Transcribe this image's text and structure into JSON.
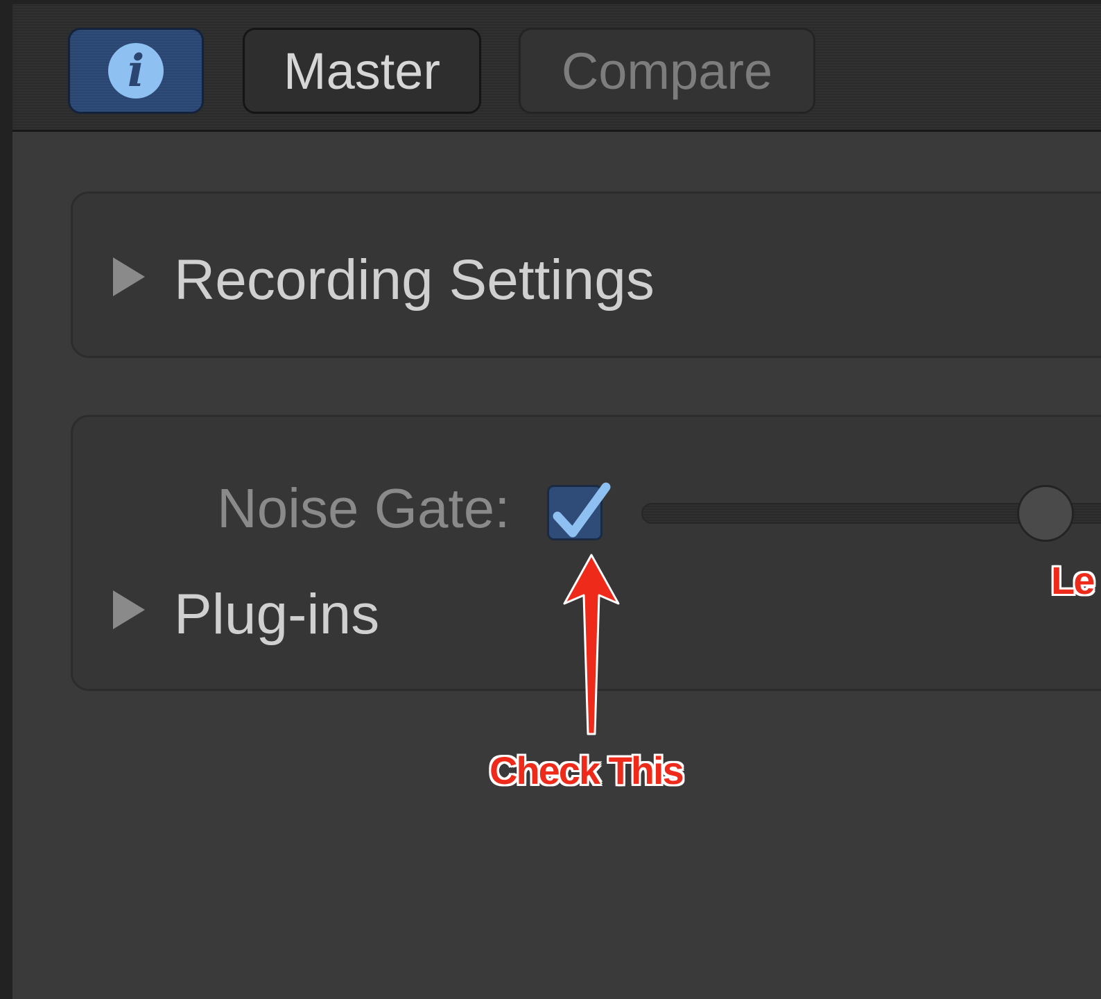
{
  "toolbar": {
    "info_button": {
      "icon": "info-icon",
      "glyph": "i",
      "accent": "#8fc0f2"
    },
    "master_label": "Master",
    "compare_label": "Compare"
  },
  "sections": {
    "recording_settings": {
      "label": "Recording Settings",
      "expanded": false
    },
    "plugins": {
      "label": "Plug-ins",
      "expanded": false
    }
  },
  "noise_gate": {
    "label": "Noise Gate:",
    "checked": true,
    "slider_value_fraction": 0.85
  },
  "annotations": {
    "check_this": "Check This",
    "level_partial": "Le",
    "color": "#ee2a1a"
  }
}
